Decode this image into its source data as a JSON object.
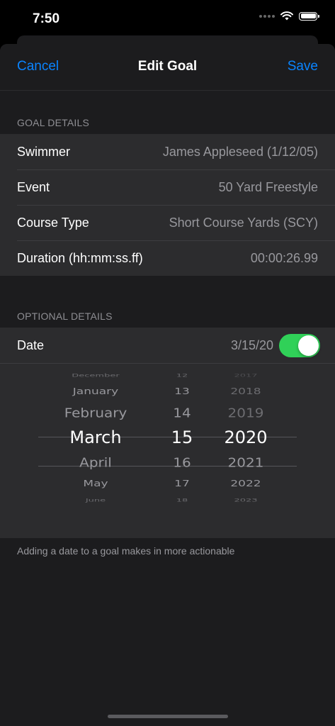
{
  "status_bar": {
    "time": "7:50"
  },
  "nav": {
    "cancel_label": "Cancel",
    "title": "Edit Goal",
    "save_label": "Save"
  },
  "goal_details": {
    "header": "GOAL DETAILS",
    "rows": [
      {
        "label": "Swimmer",
        "value": "James Appleseed (1/12/05)"
      },
      {
        "label": "Event",
        "value": "50 Yard Freestyle"
      },
      {
        "label": "Course Type",
        "value": "Short Course Yards (SCY)"
      },
      {
        "label": "Duration (hh:mm:ss.ff)",
        "value": "00:00:26.99"
      }
    ]
  },
  "optional_details": {
    "header": "OPTIONAL DETAILS",
    "date_label": "Date",
    "date_value": "3/15/20",
    "date_enabled": true
  },
  "date_picker": {
    "months": [
      "December",
      "January",
      "February",
      "March",
      "April",
      "May",
      "June"
    ],
    "days": [
      "12",
      "13",
      "14",
      "15",
      "16",
      "17",
      "18"
    ],
    "years": [
      "2017",
      "2018",
      "2019",
      "2020",
      "2021",
      "2022",
      "2023"
    ],
    "selected": {
      "month": "March",
      "day": "15",
      "year": "2020"
    }
  },
  "footer_note": "Adding a date to a goal makes in more actionable",
  "colors": {
    "accent": "#0a84ff",
    "toggle_on": "#30d158",
    "background": "#1c1c1e",
    "cell": "#2c2c2e"
  }
}
